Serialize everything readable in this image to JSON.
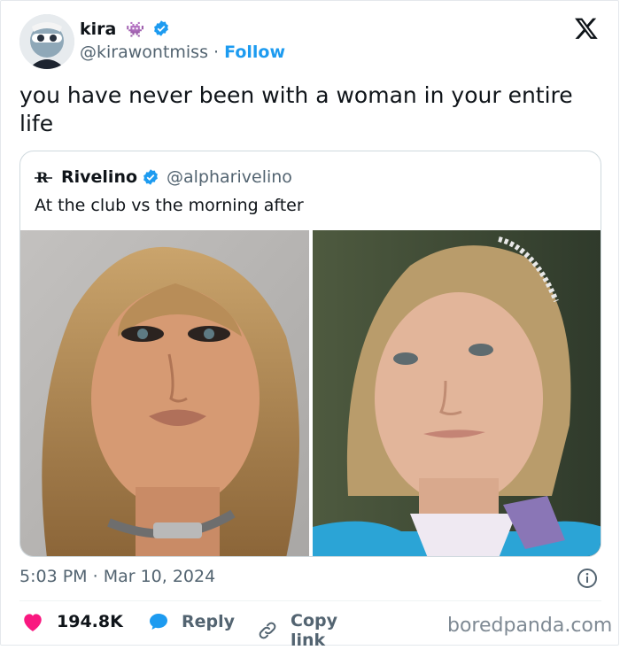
{
  "author": {
    "name": "kira",
    "emoji": "👾",
    "handle": "@kirawontmiss",
    "separator": "·",
    "follow_label": "Follow"
  },
  "tweet": {
    "text": "you have never been with a woman in your entire life",
    "time": "5:03 PM",
    "date_separator": "·",
    "date": "Mar 10, 2024"
  },
  "quoted": {
    "name": "Rivelino",
    "handle": "@alpharivelino",
    "text": "At the club vs the morning after"
  },
  "actions": {
    "likes": "194.8K",
    "reply_label": "Reply",
    "copy_label": "Copy link"
  },
  "colors": {
    "accent": "#1d9bf0",
    "like": "#f91880",
    "muted": "#536471"
  },
  "icons": [
    "verified-badge-icon",
    "x-logo-icon",
    "info-icon",
    "heart-icon",
    "reply-icon",
    "link-icon"
  ],
  "watermark": "boredpanda.com"
}
